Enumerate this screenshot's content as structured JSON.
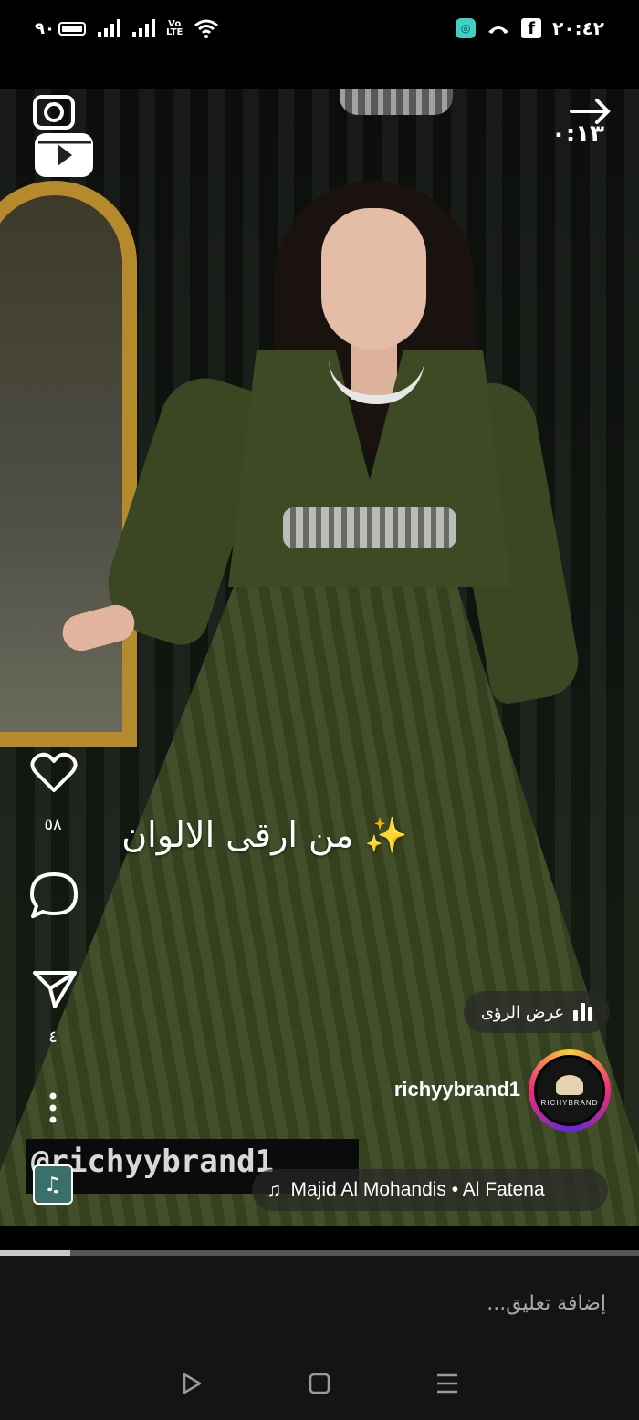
{
  "status_bar": {
    "battery_level": "٩٠",
    "network": "VoLTE",
    "clock": "٢٠:٤٢",
    "icons": [
      "battery-icon",
      "signal-icon",
      "signal-icon",
      "volte-icon",
      "wifi-icon",
      "app-notification-icon",
      "missed-call-icon",
      "facebook-icon"
    ]
  },
  "reel": {
    "timer": "٠:١٣",
    "caption": "من ارقى الالوان ✨",
    "likes_count": "٥٨",
    "shares_count": "٤",
    "insights_label": "عرض الرؤى",
    "username": "richyybrand1",
    "avatar_text": "RICHYBRAND",
    "watermark": "@richyybrand1",
    "audio": "Majid Al Mohandis • Al Fatena",
    "progress_fraction": 0.11
  },
  "comment": {
    "placeholder": "إضافة تعليق..."
  },
  "nav": {
    "buttons": [
      "back-icon",
      "home-icon",
      "recents-icon"
    ]
  }
}
